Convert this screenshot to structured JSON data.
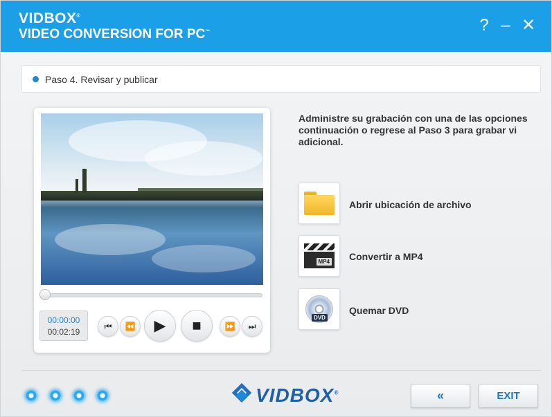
{
  "header": {
    "brand_line1": "VIDBOX",
    "brand_line1_mark": "®",
    "brand_line2": "VIDEO CONVERSION FOR PC",
    "brand_line2_mark": "™",
    "help_glyph": "?",
    "minimize_glyph": "–",
    "close_glyph": "✕"
  },
  "step": {
    "label": "Paso 4. Revisar y publicar"
  },
  "player": {
    "current_time": "00:00:00",
    "total_time": "00:02:19",
    "progress_fraction": 0,
    "controls": {
      "frame_back": "⏮",
      "rewind": "⏪",
      "play": "▶",
      "stop": "■",
      "fast_forward": "⏩",
      "frame_forward": "⏭"
    }
  },
  "instructions": {
    "line1": "Administre su grabación con una de las opciones",
    "line2": "continuación o regrese al Paso 3 para grabar vi",
    "line3": "adicional."
  },
  "actions": [
    {
      "label": "Abrir ubicación de archivo",
      "icon": "folder-icon"
    },
    {
      "label": "Convertir a MP4",
      "icon": "clapperboard-icon",
      "badge": "MP4"
    },
    {
      "label": "Quemar DVD",
      "icon": "dvd-disc-icon",
      "badge": "DVD"
    }
  ],
  "footer": {
    "page_dots": 4,
    "logo_text": "VIDBOX",
    "logo_mark": "®",
    "back_label": "«",
    "exit_label": "EXIT"
  },
  "colors": {
    "header_blue": "#1b9fe6",
    "accent_blue": "#1a78c8",
    "logo_blue": "#1f5fa8"
  }
}
